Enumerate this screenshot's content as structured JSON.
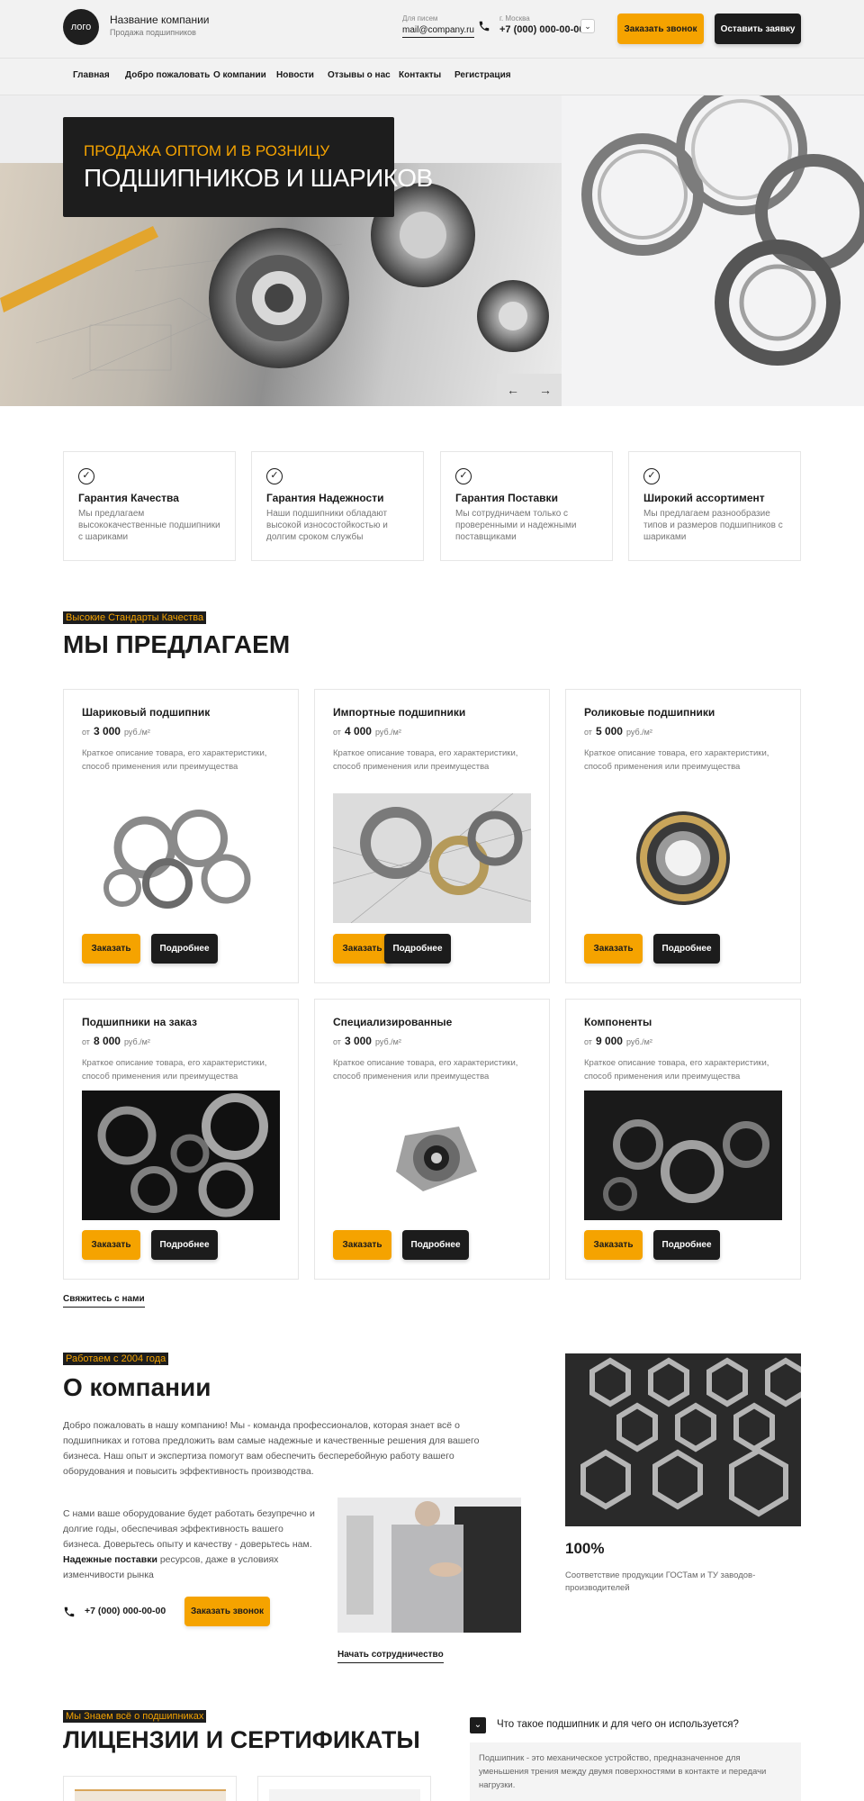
{
  "header": {
    "logo": "лого",
    "company_name": "Название компании",
    "company_tagline": "Продажа подшипников",
    "mail_label": "Для писем",
    "mail": "mail@company.ru",
    "city": "г. Москва",
    "phone": "+7 (000) 000-00-00",
    "call_button": "Заказать звонок",
    "request_button": "Оставить заявку"
  },
  "nav": [
    "Главная",
    "Добро пожаловать",
    "О компании",
    "Новости",
    "Отзывы о нас",
    "Контакты",
    "Регистрация"
  ],
  "hero": {
    "subtitle": "ПРОДАЖА ОПТОМ И В РОЗНИЦУ",
    "title": "ПОДШИПНИКОВ И ШАРИКОВ",
    "prev": "←",
    "next": "→"
  },
  "features": [
    {
      "title": "Гарантия Качества",
      "text": "Мы предлагаем высококачественные подшипники с шариками"
    },
    {
      "title": "Гарантия Надежности",
      "text": "Наши подшипники обладают высокой износостойкостью и долгим сроком службы"
    },
    {
      "title": "Гарантия Поставки",
      "text": "Мы сотрудничаем только с проверенными и надежными поставщиками"
    },
    {
      "title": "Широкий ассортимент",
      "text": "Мы предлагаем разнообразие типов и размеров подшипников с шариками"
    }
  ],
  "offers": {
    "tag": "Высокие Стандарты Качества",
    "title": "МЫ ПРЕДЛАГАЕМ",
    "price_prefix": "от",
    "price_unit": "руб./м²",
    "order_label": "Заказать",
    "more_label": "Подробнее",
    "contact_link": "Свяжитесь с нами",
    "items": [
      {
        "title": "Шариковый подшипник",
        "price": "3 000",
        "text": "Краткое описание товара, его характеристики, способ применения или преимущества"
      },
      {
        "title": "Импортные подшипники",
        "price": "4 000",
        "text": "Краткое описание товара, его характеристики, способ применения или преимущества"
      },
      {
        "title": "Роликовые подшипники",
        "price": "5 000",
        "text": "Краткое описание товара, его характеристики, способ применения или преимущества"
      },
      {
        "title": "Подшипники на заказ",
        "price": "8 000",
        "text": "Краткое описание товара, его характеристики, способ применения или преимущества"
      },
      {
        "title": "Специализированные",
        "price": "3 000",
        "text": "Краткое описание товара, его характеристики, способ применения или преимущества"
      },
      {
        "title": "Компоненты",
        "price": "9 000",
        "text": "Краткое описание товара, его характеристики, способ применения или преимущества"
      }
    ]
  },
  "about": {
    "tag": "Работаем с 2004 года",
    "title": "О компании",
    "text1": "Добро пожаловать в нашу компанию! Мы - команда профессионалов, которая знает всё о подшипниках и готова предложить вам самые надежные и качественные решения для вашего бизнеса. Наш опыт и экспертиза помогут вам обеспечить бесперебойную работу вашего оборудования и повысить эффективность производства.",
    "text2_a": "С нами ваше оборудование будет работать безупречно и долгие годы, обеспечивая эффективность вашего бизнеса. Доверьтесь опыту и качеству - доверьтесь нам.",
    "text2_bold": "Надежные поставки",
    "text2_b": "ресурсов, даже в условиях изменчивости рынка",
    "phone": "+7 (000) 000-00-00",
    "call_button": "Заказать звонок",
    "start_link": "Начать сотрудничество",
    "stat_value": "100%",
    "stat_text": "Соответствие продукции ГОСТам и ТУ заводов-производителей"
  },
  "licenses": {
    "tag": "Мы  Знаем всё о подшипниках",
    "title": "ЛИЦЕНЗИИ И СЕРТИФИКАТЫ"
  },
  "faq": {
    "question": "Что такое подшипник и для чего он используется?",
    "answer": "Подшипник - это механическое устройство, предназначенное для уменьшения трения между двумя поверхностями в контакте и передачи нагрузки."
  },
  "colors": {
    "accent": "#f5a300",
    "dark": "#1c1c1c"
  }
}
